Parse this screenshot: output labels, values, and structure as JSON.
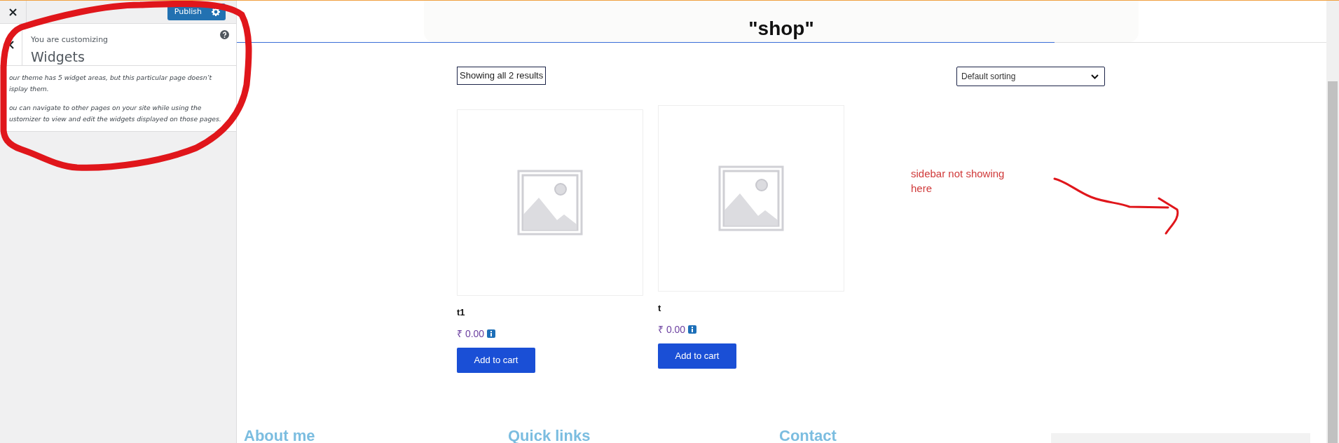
{
  "customizer": {
    "publish_button": "Publish",
    "context_label": "You are customizing",
    "section_title": "Widgets",
    "notice": [
      {
        "lines": [
          "our theme has 5 widget areas, but this particular page doesn’t",
          "isplay them."
        ]
      },
      {
        "lines": [
          "ou can navigate to other pages on your site while using the",
          "ustomizer to view and edit the widgets displayed on those pages."
        ]
      }
    ]
  },
  "preview": {
    "page_title": "\"shop\"",
    "result_count": "Showing all 2 results",
    "sorting": {
      "value": "Default sorting"
    },
    "products": [
      {
        "name": "t1",
        "price": "₹ 0.00",
        "button": "Add to cart"
      },
      {
        "name": "t",
        "price": "₹ 0.00",
        "button": "Add to cart"
      }
    ],
    "footer_headings": [
      "About me",
      "Quick links",
      "Contact"
    ]
  },
  "annotation": {
    "text": "sidebar not showing here"
  }
}
